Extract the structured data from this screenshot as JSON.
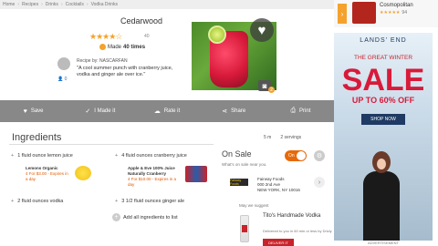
{
  "breadcrumb": [
    "Home",
    "Recipes",
    "Drinks",
    "Cocktails",
    "Vodka Drinks"
  ],
  "sidebar_promo": {
    "title": "Cosmopolitan",
    "count": "94"
  },
  "recipe": {
    "title": "Cedarwood",
    "rating_count": "40",
    "made_prefix": "Made",
    "made_count": "40 times",
    "by": "Recipe by: NASCARFAN",
    "quote": "\"A cool summer punch with cranberry juice, vodka and ginger ale over ice.\"",
    "followers": "0",
    "photo_count": "2"
  },
  "actions": [
    "Save",
    "I Made it",
    "Rate it",
    "Share",
    "Print"
  ],
  "ingredients": {
    "title": "Ingredients",
    "time": "5 m",
    "servings": "2 servings",
    "items": [
      "1 fluid ounce lemon juice",
      "4 fluid ounces cranberry juice",
      "2 fluid ounces vodka",
      "3 1/2 fluid ounces ginger ale"
    ],
    "brand1": {
      "name": "Lemons Organic",
      "offer": "4 For $3.00 - Expires in a day"
    },
    "brand2": {
      "name": "Apple & Eve 100% Juice Naturally Cranberry",
      "offer": "4 For $10.00 - Expires in a day"
    },
    "add_all": "Add all ingredients to list"
  },
  "onsale": {
    "title": "On Sale",
    "subtitle": "What's on sale near you.",
    "toggle": "On",
    "store_name": "Fairway Foods",
    "store_addr1": "000 2nd Ave",
    "store_addr2": "NEW YORK, NY 10016",
    "suggest": "May we suggest",
    "product": "Tito's Handmade Vodka",
    "product_desc": "Delivered to you in 60 min or less by Drizly",
    "ship_btn": "DELIVER IT"
  },
  "ad": {
    "brand": "LANDS' END",
    "line1": "THE GREAT WINTER",
    "sale": "SALE",
    "pct": "UP TO 60% OFF",
    "cta": "SHOP NOW",
    "label": "ADVERTISEMENT"
  }
}
